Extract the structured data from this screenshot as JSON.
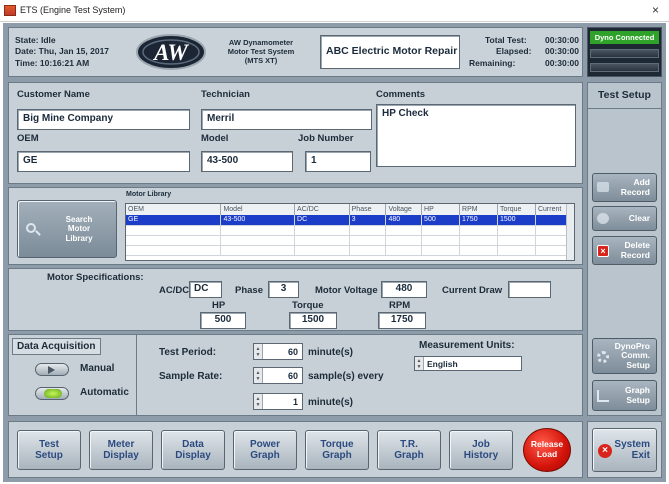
{
  "window": {
    "title": "ETS (Engine Test System)",
    "close": "×"
  },
  "status": {
    "state_label": "State:",
    "state_value": "Idle",
    "date_label": "Date:",
    "date_value": "Thu, Jan 15, 2017",
    "time_label": "Time:",
    "time_value": "10:16:21 AM"
  },
  "branding": {
    "logo_text": "AW",
    "line1": "AW Dynamometer",
    "line2": "Motor Test System",
    "line3": "(MTS XT)",
    "company": "ABC Electric Motor Repair"
  },
  "timers": {
    "total_label": "Total Test:",
    "total_value": "00:30:00",
    "elapsed_label": "Elapsed:",
    "elapsed_value": "00:30:00",
    "remaining_label": "Remaining:",
    "remaining_value": "00:30:00"
  },
  "dyno": {
    "status": "Dyno Connected",
    "color": "#2fa329"
  },
  "form": {
    "customer_label": "Customer Name",
    "customer_value": "Big Mine Company",
    "technician_label": "Technician",
    "technician_value": "Merril",
    "comments_label": "Comments",
    "comments_value": "HP Check",
    "oem_label": "OEM",
    "oem_value": "GE",
    "model_label": "Model",
    "model_value": "43-500",
    "job_label": "Job Number",
    "job_value": "1"
  },
  "library": {
    "title": "Motor Library",
    "search_button": [
      "Search",
      "Motor",
      "Library"
    ],
    "columns": [
      "OEM",
      "Model",
      "AC/DC",
      "Phase",
      "Voltage",
      "HP",
      "RPM",
      "Torque",
      "Current"
    ],
    "rows": [
      [
        "GE",
        "43-500",
        "DC",
        "3",
        "480",
        "500",
        "1750",
        "1500",
        ""
      ]
    ]
  },
  "specs": {
    "title": "Motor Specifications:",
    "acdc_label": "AC/DC",
    "acdc_value": "DC",
    "phase_label": "Phase",
    "phase_value": "3",
    "voltage_label": "Motor Voltage",
    "voltage_value": "480",
    "current_label": "Current Draw",
    "current_value": "",
    "hp_label": "HP",
    "hp_value": "500",
    "torque_label": "Torque",
    "torque_value": "1500",
    "rpm_label": "RPM",
    "rpm_value": "1750"
  },
  "acquisition": {
    "title": "Data Acquisition",
    "manual": "Manual",
    "automatic": "Automatic",
    "test_period_label": "Test Period:",
    "test_period_value": "60",
    "test_period_unit": "minute(s)",
    "sample_rate_label": "Sample Rate:",
    "sample_rate_value": "60",
    "sample_rate_unit": "sample(s) every",
    "every_value": "1",
    "every_unit": "minute(s)",
    "units_label": "Measurement Units:",
    "units_value": "English"
  },
  "sidebar": {
    "title": "Test Setup",
    "add": [
      "Add",
      "Record"
    ],
    "clear": [
      "Clear"
    ],
    "delete": [
      "Delete",
      "Record"
    ],
    "comm": [
      "DynoPro",
      "Comm.",
      "Setup"
    ],
    "graph": [
      "Graph",
      "Setup"
    ],
    "exit": [
      "System",
      "Exit"
    ]
  },
  "bottom_nav": [
    [
      "Test",
      "Setup"
    ],
    [
      "Meter",
      "Display"
    ],
    [
      "Data",
      "Display"
    ],
    [
      "Power",
      "Graph"
    ],
    [
      "Torque",
      "Graph"
    ],
    [
      "T.R.",
      "Graph"
    ],
    [
      "Job",
      "History"
    ]
  ],
  "release": [
    "Release",
    "Load"
  ]
}
